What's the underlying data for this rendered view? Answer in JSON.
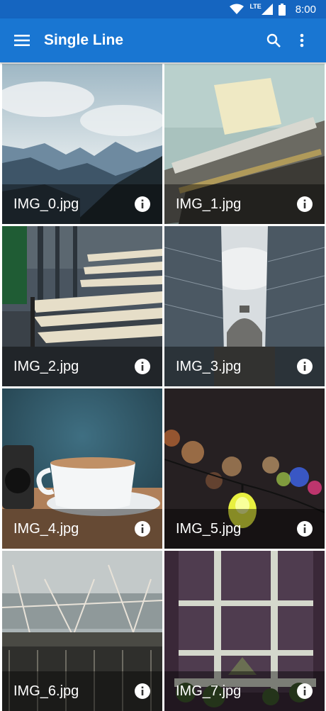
{
  "status_bar": {
    "time": "8:00",
    "network": "LTE"
  },
  "app_bar": {
    "title": "Single Line",
    "menu_icon": "hamburger-menu-icon",
    "search_icon": "search-icon",
    "overflow_icon": "more-vert-icon",
    "color": "#1976d2"
  },
  "images": [
    {
      "name": "IMG_0.jpg",
      "subject": "mountain-landscape"
    },
    {
      "name": "IMG_1.jpg",
      "subject": "typewriter"
    },
    {
      "name": "IMG_2.jpg",
      "subject": "wet-bench"
    },
    {
      "name": "IMG_3.jpg",
      "subject": "cathedral-between-glass-buildings"
    },
    {
      "name": "IMG_4.jpg",
      "subject": "coffee-cup-and-camera"
    },
    {
      "name": "IMG_5.jpg",
      "subject": "bokeh-lights-bulb"
    },
    {
      "name": "IMG_6.jpg",
      "subject": "barbed-wire-fence"
    },
    {
      "name": "IMG_7.jpg",
      "subject": "window-with-plants"
    }
  ]
}
